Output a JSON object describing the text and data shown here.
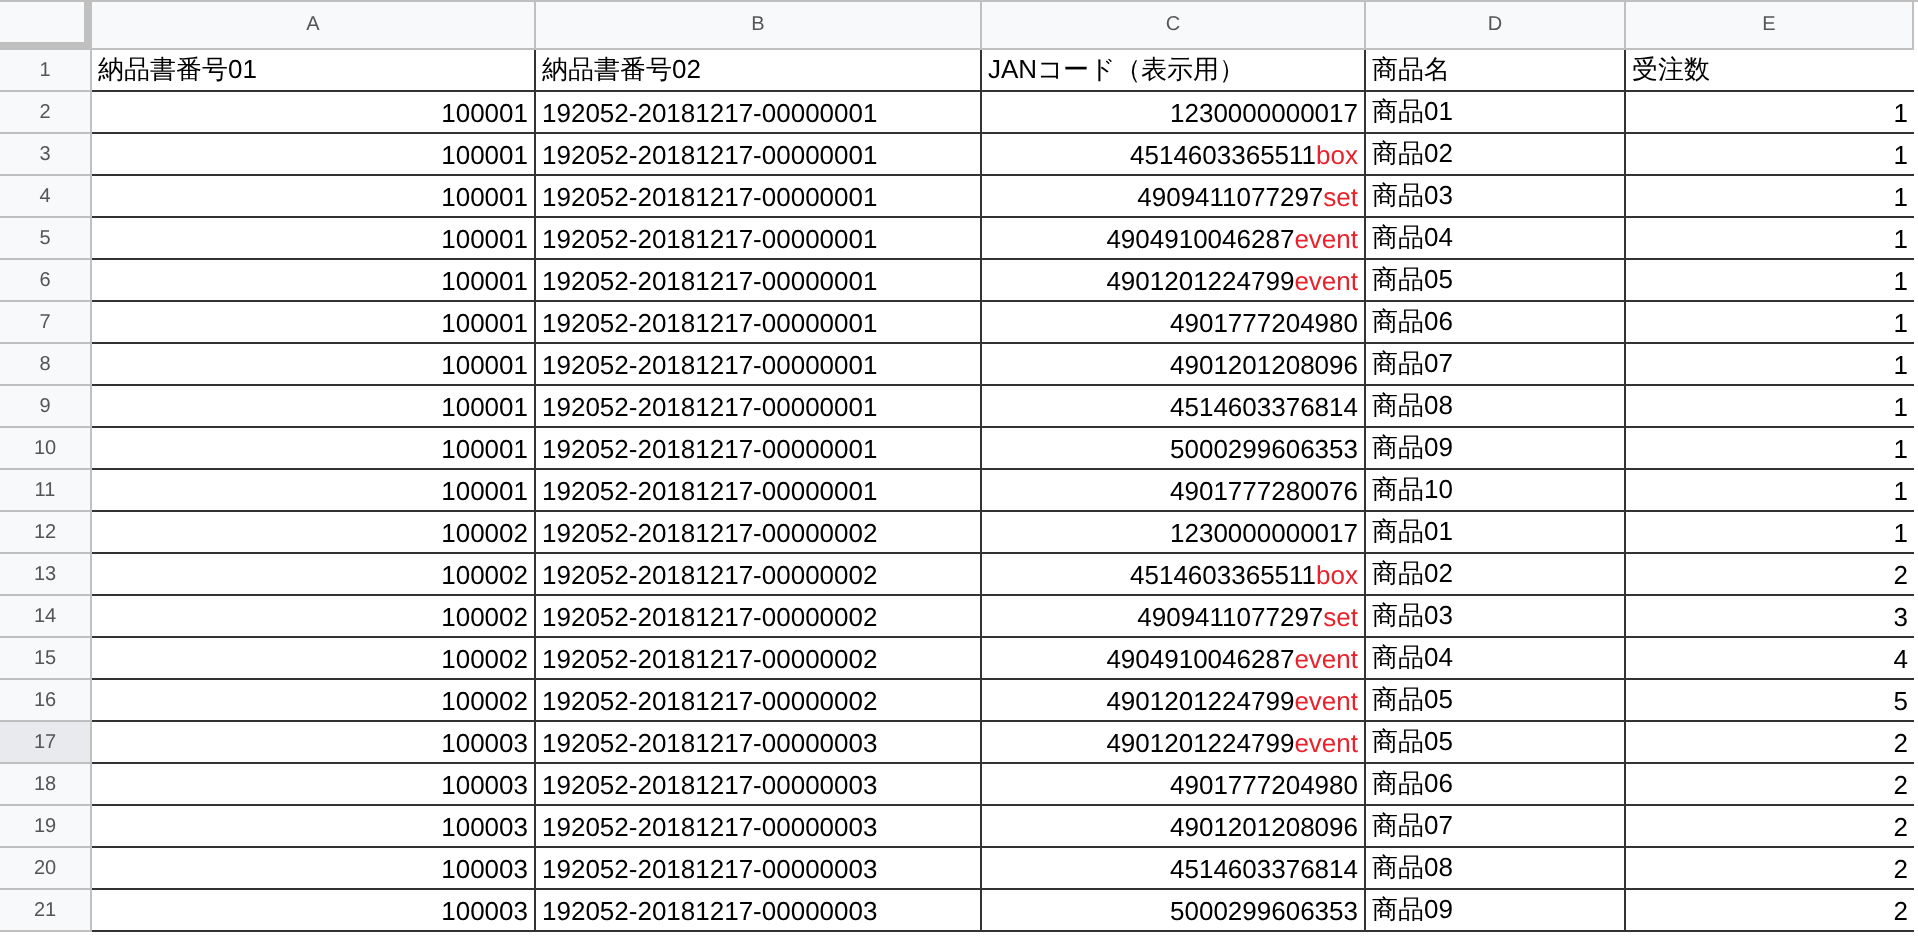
{
  "columns": [
    "A",
    "B",
    "C",
    "D",
    "E"
  ],
  "rows": [
    {
      "num": "1",
      "kind": "header",
      "hovered": false,
      "cells": [
        "納品書番号01",
        "納品書番号02",
        "JANコード（表示用）",
        "商品名",
        "受注数"
      ]
    },
    {
      "num": "2",
      "kind": "data",
      "hovered": false,
      "a": "100001",
      "b": "192052-20181217-00000001",
      "jan": "1230000000017",
      "name": "商品01",
      "qty": "1"
    },
    {
      "num": "3",
      "kind": "data",
      "hovered": false,
      "a": "100001",
      "b": "192052-20181217-00000001",
      "jan": "4514603365511",
      "suffix": "box",
      "name": "商品02",
      "qty": "1"
    },
    {
      "num": "4",
      "kind": "data",
      "hovered": false,
      "a": "100001",
      "b": "192052-20181217-00000001",
      "jan": "4909411077297",
      "suffix": "set",
      "name": "商品03",
      "qty": "1"
    },
    {
      "num": "5",
      "kind": "data",
      "hovered": false,
      "a": "100001",
      "b": "192052-20181217-00000001",
      "jan": "4904910046287",
      "suffix": "event",
      "name": "商品04",
      "qty": "1"
    },
    {
      "num": "6",
      "kind": "data",
      "hovered": false,
      "a": "100001",
      "b": "192052-20181217-00000001",
      "jan": "4901201224799",
      "suffix": "event",
      "name": "商品05",
      "qty": "1"
    },
    {
      "num": "7",
      "kind": "data",
      "hovered": false,
      "a": "100001",
      "b": "192052-20181217-00000001",
      "jan": "4901777204980",
      "name": "商品06",
      "qty": "1"
    },
    {
      "num": "8",
      "kind": "data",
      "hovered": false,
      "a": "100001",
      "b": "192052-20181217-00000001",
      "jan": "4901201208096",
      "name": "商品07",
      "qty": "1"
    },
    {
      "num": "9",
      "kind": "data",
      "hovered": false,
      "a": "100001",
      "b": "192052-20181217-00000001",
      "jan": "4514603376814",
      "name": "商品08",
      "qty": "1"
    },
    {
      "num": "10",
      "kind": "data",
      "hovered": false,
      "a": "100001",
      "b": "192052-20181217-00000001",
      "jan": "5000299606353",
      "name": "商品09",
      "qty": "1"
    },
    {
      "num": "11",
      "kind": "data",
      "hovered": false,
      "a": "100001",
      "b": "192052-20181217-00000001",
      "jan": "4901777280076",
      "name": "商品10",
      "qty": "1"
    },
    {
      "num": "12",
      "kind": "data",
      "hovered": false,
      "a": "100002",
      "b": "192052-20181217-00000002",
      "jan": "1230000000017",
      "name": "商品01",
      "qty": "1"
    },
    {
      "num": "13",
      "kind": "data",
      "hovered": false,
      "a": "100002",
      "b": "192052-20181217-00000002",
      "jan": "4514603365511",
      "suffix": "box",
      "name": "商品02",
      "qty": "2"
    },
    {
      "num": "14",
      "kind": "data",
      "hovered": false,
      "a": "100002",
      "b": "192052-20181217-00000002",
      "jan": "4909411077297",
      "suffix": "set",
      "name": "商品03",
      "qty": "3"
    },
    {
      "num": "15",
      "kind": "data",
      "hovered": false,
      "a": "100002",
      "b": "192052-20181217-00000002",
      "jan": "4904910046287",
      "suffix": "event",
      "name": "商品04",
      "qty": "4"
    },
    {
      "num": "16",
      "kind": "data",
      "hovered": false,
      "a": "100002",
      "b": "192052-20181217-00000002",
      "jan": "4901201224799",
      "suffix": "event",
      "name": "商品05",
      "qty": "5"
    },
    {
      "num": "17",
      "kind": "data",
      "hovered": true,
      "a": "100003",
      "b": "192052-20181217-00000003",
      "jan": "4901201224799",
      "suffix": "event",
      "name": "商品05",
      "qty": "2"
    },
    {
      "num": "18",
      "kind": "data",
      "hovered": false,
      "a": "100003",
      "b": "192052-20181217-00000003",
      "jan": "4901777204980",
      "name": "商品06",
      "qty": "2"
    },
    {
      "num": "19",
      "kind": "data",
      "hovered": false,
      "a": "100003",
      "b": "192052-20181217-00000003",
      "jan": "4901201208096",
      "name": "商品07",
      "qty": "2"
    },
    {
      "num": "20",
      "kind": "data",
      "hovered": false,
      "a": "100003",
      "b": "192052-20181217-00000003",
      "jan": "4514603376814",
      "name": "商品08",
      "qty": "2"
    },
    {
      "num": "21",
      "kind": "data",
      "hovered": false,
      "a": "100003",
      "b": "192052-20181217-00000003",
      "jan": "5000299606353",
      "name": "商品09",
      "qty": "2"
    }
  ]
}
